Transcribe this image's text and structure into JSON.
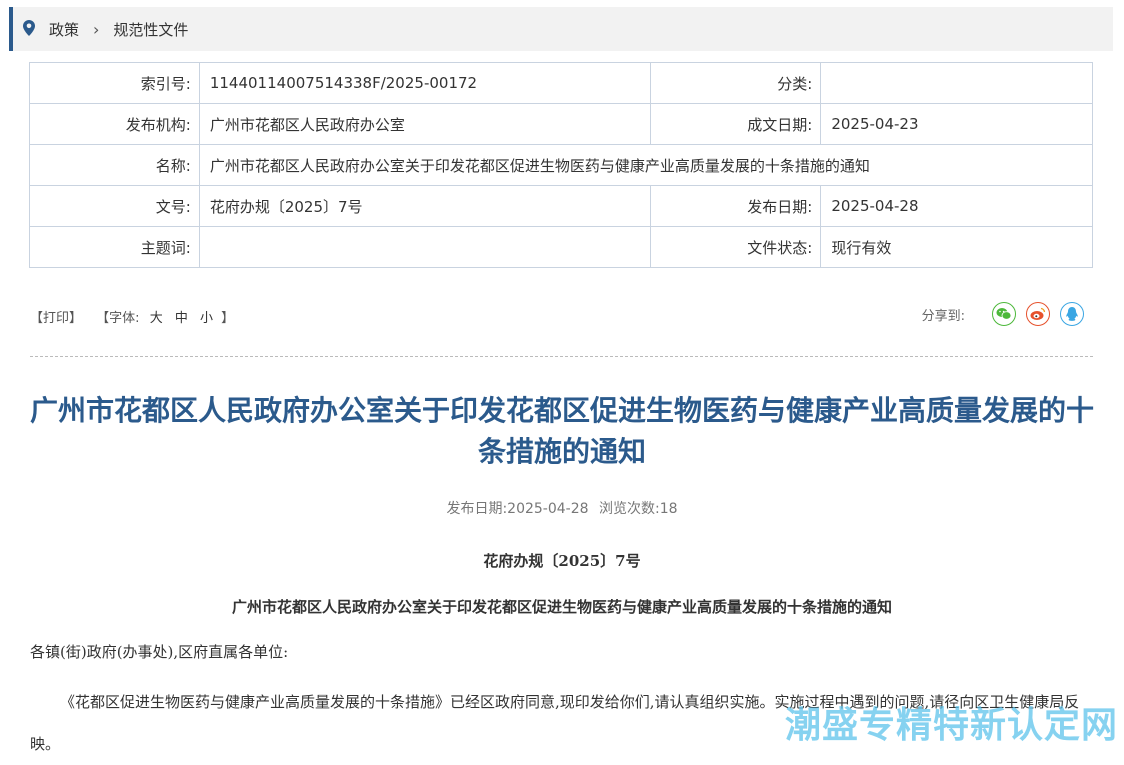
{
  "breadcrumb": {
    "items": [
      "政策",
      "规范性文件"
    ]
  },
  "meta": {
    "index_label": "索引号:",
    "index_value": "11440114007514338F/2025-00172",
    "category_label": "分类:",
    "category_value": "",
    "publisher_label": "发布机构:",
    "publisher_value": "广州市花都区人民政府办公室",
    "written_date_label": "成文日期:",
    "written_date_value": "2025-04-23",
    "name_label": "名称:",
    "name_value": "广州市花都区人民政府办公室关于印发花都区促进生物医药与健康产业高质量发展的十条措施的通知",
    "docno_label": "文号:",
    "docno_value": "花府办规〔2025〕7号",
    "publish_date_label": "发布日期:",
    "publish_date_value": "2025-04-28",
    "keywords_label": "主题词:",
    "keywords_value": "",
    "status_label": "文件状态:",
    "status_value": "现行有效"
  },
  "tools": {
    "print": "【打印】",
    "font_open": "【字体:",
    "font_large": "大",
    "font_medium": "中",
    "font_small": "小",
    "font_close": "】"
  },
  "share": {
    "label": "分享到:",
    "buttons": [
      {
        "icon": "wechat-icon",
        "color": "#4cb83a"
      },
      {
        "icon": "weibo-icon",
        "color": "#e6512c"
      },
      {
        "icon": "qq-icon",
        "color": "#3aa6e3"
      }
    ]
  },
  "article": {
    "title": "广州市花都区人民政府办公室关于印发花都区促进生物医药与健康产业高质量发展的十条措施的通知",
    "publish_date_label": "发布日期:",
    "publish_date": "2025-04-28",
    "views_label": "浏览次数:",
    "views": "18",
    "doc_number": "花府办规〔2025〕7号",
    "doc_title": "广州市花都区人民政府办公室关于印发花都区促进生物医药与健康产业高质量发展的十条措施的通知",
    "salutation": "各镇(街)政府(办事处),区府直属各单位:",
    "paragraph": "《花都区促进生物医药与健康产业高质量发展的十条措施》已经区政府同意,现印发给你们,请认真组织实施。实施过程中遇到的问题,请径向区卫生健康局反映。"
  },
  "watermark": "潮盛专精特新认定网",
  "colors": {
    "accent": "#2b5a8c",
    "border": "#c9d3e0",
    "breadcrumb_bg": "#f2f2f2"
  }
}
